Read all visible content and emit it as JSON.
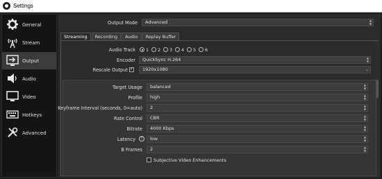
{
  "window": {
    "title": "Settings"
  },
  "sidebar": {
    "items": [
      {
        "label": "General",
        "icon": "gear-icon"
      },
      {
        "label": "Stream",
        "icon": "antenna-icon"
      },
      {
        "label": "Output",
        "icon": "monitor-out-icon",
        "active": true
      },
      {
        "label": "Audio",
        "icon": "speaker-icon"
      },
      {
        "label": "Video",
        "icon": "display-icon"
      },
      {
        "label": "Hotkeys",
        "icon": "keyboard-icon"
      },
      {
        "label": "Advanced",
        "icon": "tools-icon"
      }
    ]
  },
  "output_mode": {
    "label": "Output Mode",
    "value": "Advanced"
  },
  "tabs": [
    {
      "label": "Streaming",
      "active": true
    },
    {
      "label": "Recording"
    },
    {
      "label": "Audio"
    },
    {
      "label": "Replay Buffer"
    }
  ],
  "audio_track": {
    "label": "Audio Track",
    "options": [
      "1",
      "2",
      "3",
      "4",
      "5",
      "6"
    ],
    "selected": "1"
  },
  "encoder": {
    "label": "Encoder",
    "value": "QuickSync H.264"
  },
  "rescale": {
    "label": "Rescale Output",
    "checked": true,
    "value": "1920x1080"
  },
  "settings": {
    "target_usage": {
      "label": "Target Usage",
      "value": "balanced"
    },
    "profile": {
      "label": "Profile",
      "value": "high"
    },
    "keyframe": {
      "label": "Keyframe Interval (seconds, 0=auto)",
      "value": "2"
    },
    "rate_control": {
      "label": "Rate Control",
      "value": "CBR"
    },
    "bitrate": {
      "label": "Bitrate",
      "value": "4000 Kbps"
    },
    "latency": {
      "label": "Latency",
      "value": "low"
    },
    "bframes": {
      "label": "B Frames",
      "value": "2"
    },
    "sve": {
      "label": "Subjective Video Enhancements",
      "checked": false
    }
  },
  "colors": {
    "accent": "#3a3a3a",
    "background": "#2b2b2b",
    "sidebar": "#141414"
  }
}
